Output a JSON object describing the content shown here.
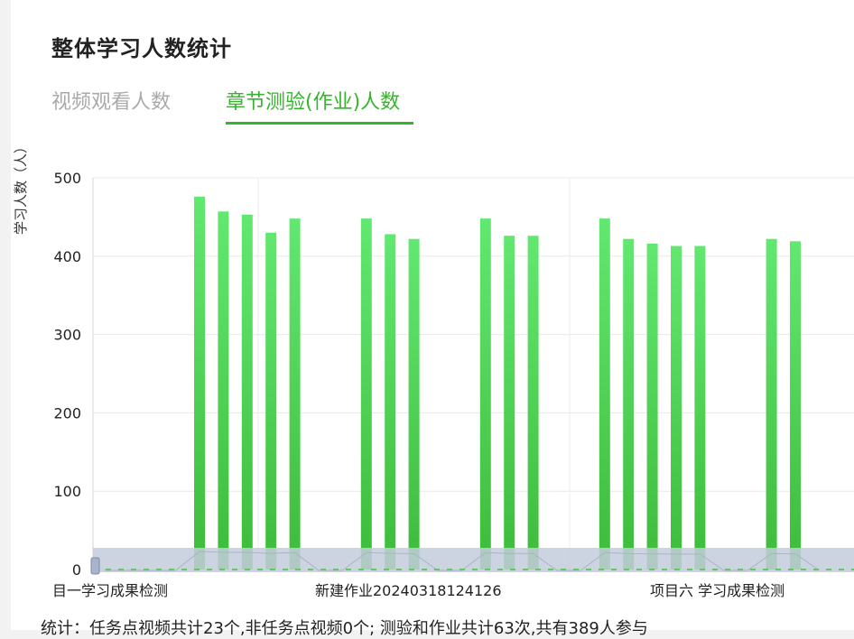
{
  "title": "整体学习人数统计",
  "tabs": [
    {
      "label": "视频观看人数",
      "active": false
    },
    {
      "label": "章节测验(作业)人数",
      "active": true
    }
  ],
  "colors": {
    "accent": "#35b52b",
    "bar_top": "#62e870",
    "bar_bottom": "#3dbb3a",
    "slider_fill": "#c4ccdc"
  },
  "chart_data": {
    "type": "bar",
    "ylabel": "学习人数（人）",
    "ylim": [
      0,
      500
    ],
    "yticks": [
      500,
      400,
      300,
      200,
      100,
      0
    ],
    "grid": true,
    "x_tick_labels": [
      "目一学习成果检测",
      "新建作业20240318124126",
      "项目六 学习成果检测"
    ],
    "values": [
      0,
      0,
      0,
      0,
      476,
      457,
      453,
      430,
      448,
      0,
      0,
      448,
      428,
      422,
      0,
      0,
      448,
      426,
      426,
      0,
      0,
      448,
      422,
      416,
      413,
      413,
      0,
      0,
      422,
      419,
      0
    ],
    "dataZoom": "slider"
  },
  "footer": "统计：任务点视频共计23个,非任务点视频0个; 测验和作业共计63次,共有389人参与"
}
